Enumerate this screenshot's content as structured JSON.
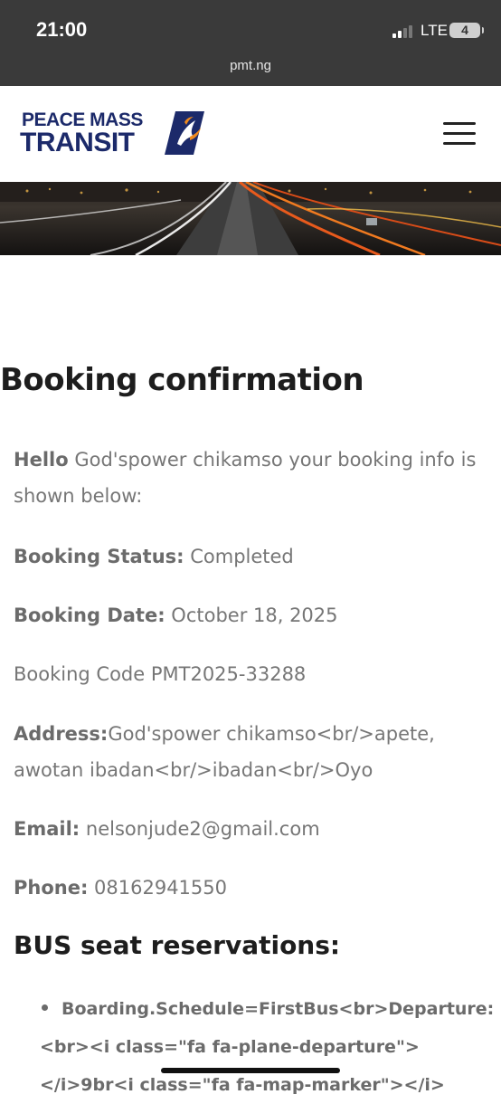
{
  "status_bar": {
    "time": "21:00",
    "network": "LTE",
    "battery": "4"
  },
  "browser": {
    "url": "pmt.ng"
  },
  "header": {
    "logo_line1": "PEACE MASS",
    "logo_line2": "TRANSIT",
    "menu_icon": "hamburger-icon",
    "logo_colors": {
      "navy": "#1c2a6a",
      "orange": "#f08a1c"
    }
  },
  "banner": {
    "image": "night-highway-light-trails"
  },
  "page": {
    "title": "Booking confirmation",
    "greeting_label": "Hello",
    "greeting_text": " God'spower chikamso your booking info is shown below:",
    "status_label": "Booking Status:",
    "status_value": " Completed",
    "date_label": "Booking Date:",
    "date_value": " October 18, 2025",
    "code_line": "Booking Code PMT2025-33288",
    "address_label": "Address:",
    "address_value": "God'spower chikamso<br/>apete, awotan ibadan<br/>ibadan<br/>Oyo",
    "email_label": "Email:",
    "email_value": " nelsonjude2@gmail.com",
    "phone_label": "Phone:",
    "phone_value": " 08162941550",
    "section_title": "BUS seat reservations:",
    "reservation_lines": [
      "Boarding.Schedule=FirstBus<br>Departure:",
      "<br><i class=\"fa fa-plane-departure\">",
      "</i>9br<i class=\"fa fa-map-marker\"></i>"
    ]
  }
}
